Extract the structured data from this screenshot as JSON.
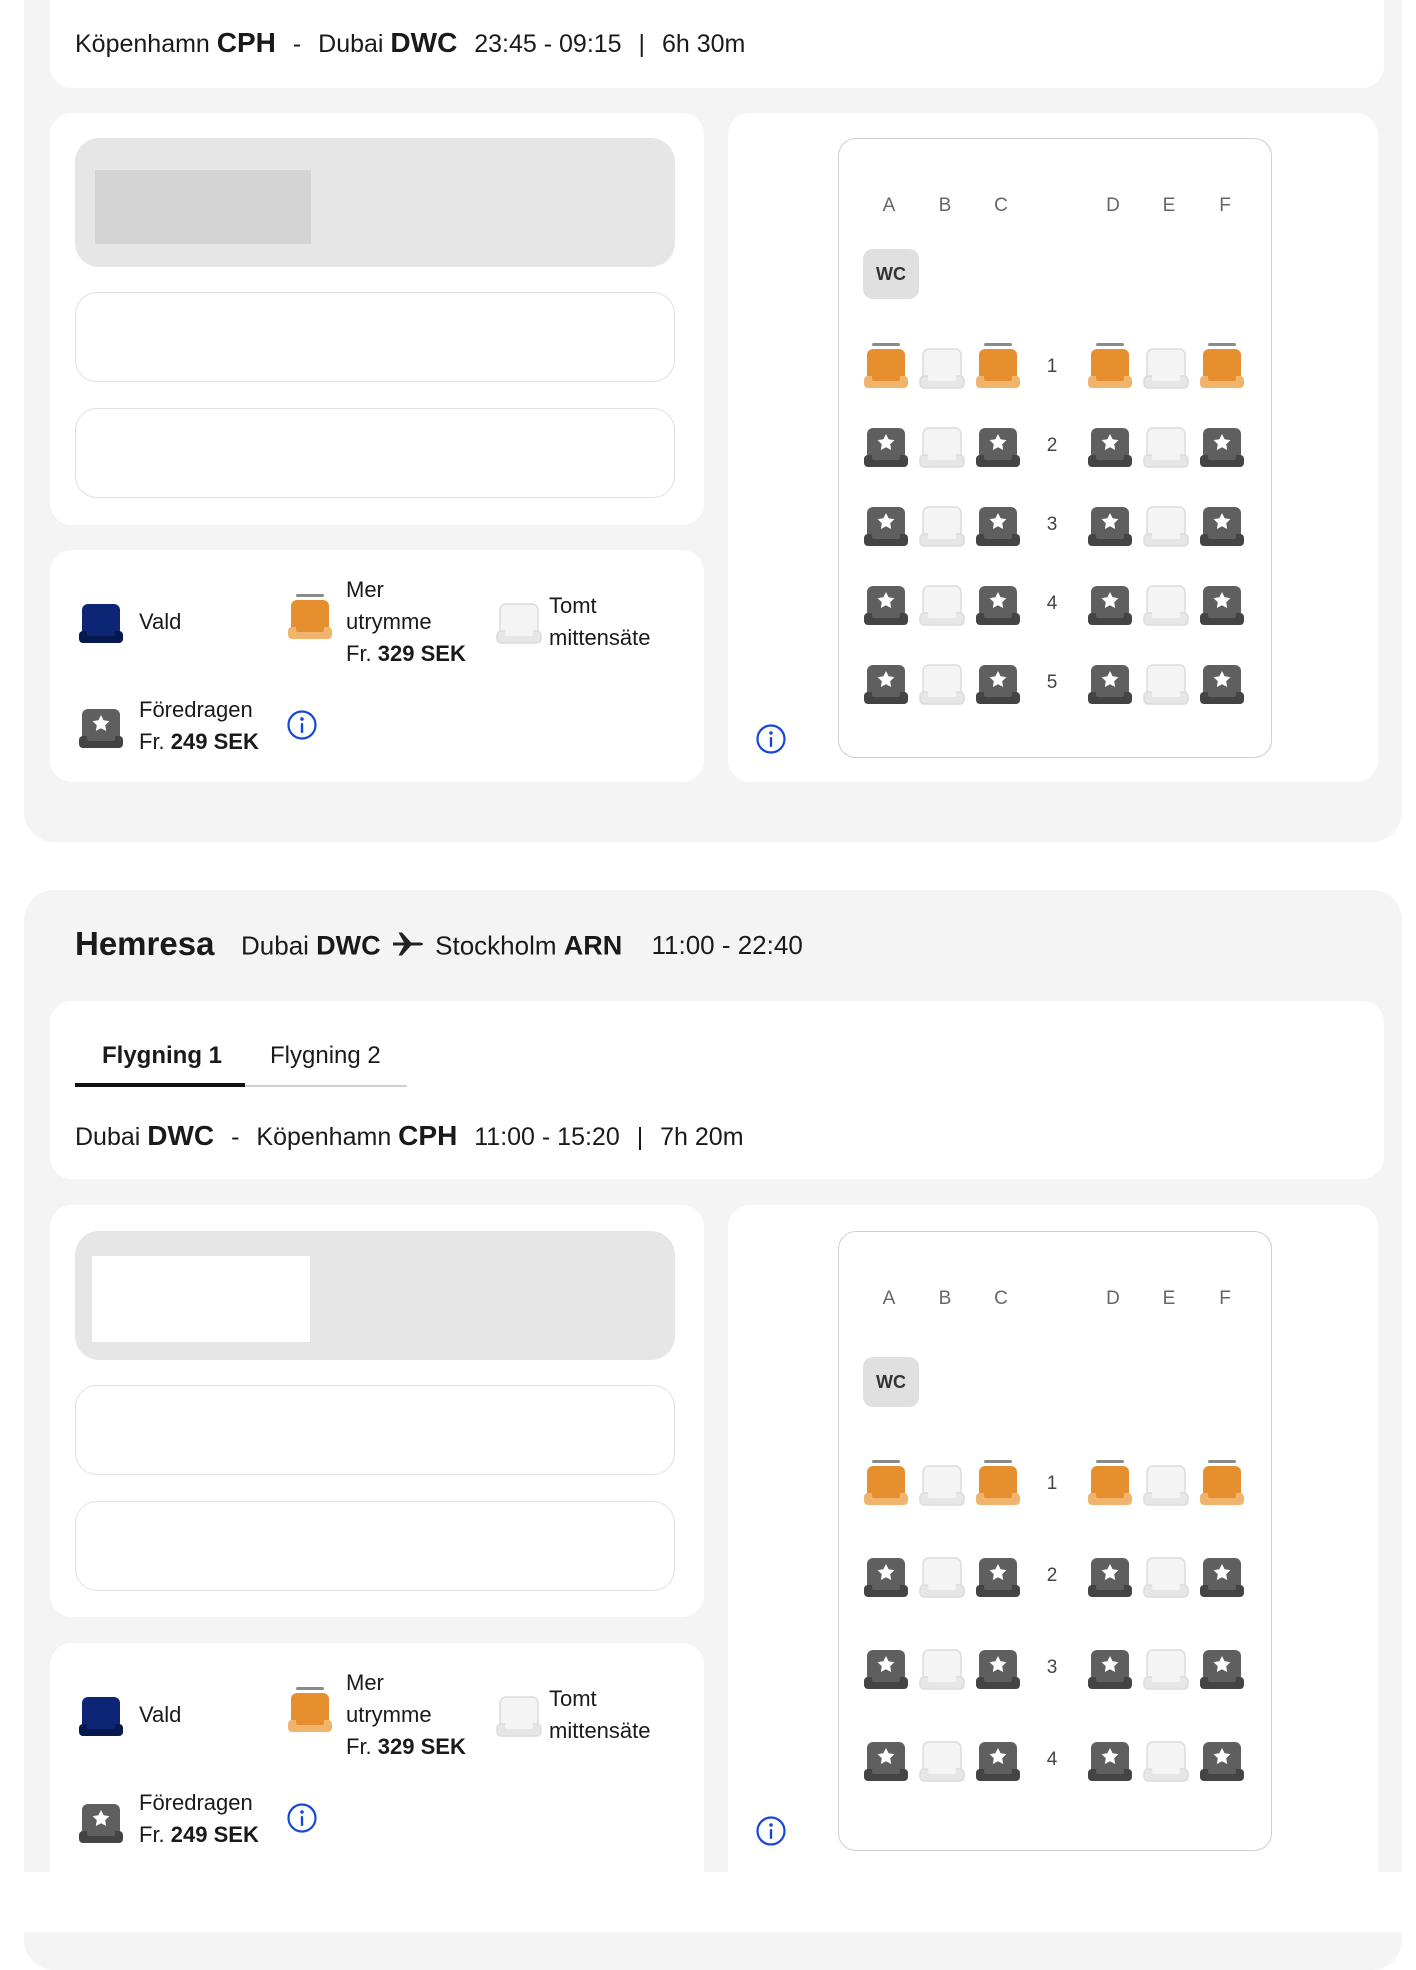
{
  "outbound_segment": {
    "origin_city": "Köpenhamn",
    "origin_code": "CPH",
    "dest_city": "Dubai",
    "dest_code": "DWC",
    "times": "23:45 - 09:15",
    "duration": "6h 30m",
    "dash": "-",
    "pipe": "|"
  },
  "legend": {
    "selected": "Vald",
    "extra_line1": "Mer",
    "extra_line2": "utrymme",
    "extra_price_prefix": "Fr.",
    "extra_price": "329 SEK",
    "empty_line1": "Tomt",
    "empty_line2": "mittensäte",
    "preferred": "Föredragen",
    "preferred_price_prefix": "Fr.",
    "preferred_price": "249 SEK"
  },
  "seatmap": {
    "columns": [
      "A",
      "B",
      "C",
      "D",
      "E",
      "F"
    ],
    "wc_label": "WC",
    "rows_outbound": [
      "1",
      "2",
      "3",
      "4",
      "5"
    ],
    "rows_return": [
      "1",
      "2",
      "3",
      "4"
    ]
  },
  "hemresa": {
    "title": "Hemresa",
    "origin_city": "Dubai",
    "origin_code": "DWC",
    "dest_city": "Stockholm",
    "dest_code": "ARN",
    "times": "11:00 - 22:40",
    "tabs": [
      "Flygning 1",
      "Flygning 2"
    ],
    "segment": {
      "origin_city": "Dubai",
      "origin_code": "DWC",
      "dest_city": "Köpenhamn",
      "dest_code": "CPH",
      "times": "11:00 - 15:20",
      "duration": "7h 20m"
    }
  },
  "colors": {
    "section_bg": "#f4f4f4",
    "selected_seat": "#0c2574",
    "extra_seat": "#e58f2e",
    "preferred_seat": "#5f5f5f",
    "empty_seat": "#f4f4f4",
    "info_blue": "#1747d8"
  }
}
